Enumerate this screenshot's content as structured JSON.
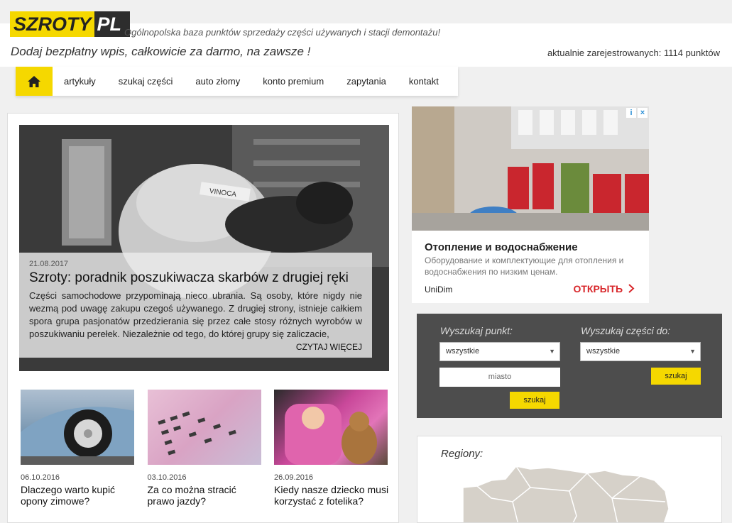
{
  "header": {
    "logo_part1": "SZROTY",
    "logo_part2": "PL",
    "tagline": "Ogólnopolska baza punktów sprzedaży części używanych i stacji demontażu!",
    "promo": "Dodaj bezpłatny wpis, całkowicie za darmo, na zawsze !",
    "registered": "aktualnie zarejestrowanych: 1114 punktów"
  },
  "nav": {
    "home_icon": "home-icon",
    "items": [
      "artykuły",
      "szukaj części",
      "auto złomy",
      "konto premium",
      "zapytania",
      "kontakt"
    ]
  },
  "hero": {
    "date": "21.08.2017",
    "title": "Szroty: poradnik poszukiwacza skarbów z drugiej ręki",
    "text": "Części samochodowe przypominają nieco ubrania. Są osoby, które nigdy nie wezmą pod uwagę zakupu czegoś używanego. Z drugiej strony, istnieje całkiem spora grupa pasjonatów przedzierania się przez całe stosy różnych wyrobów w poszukiwaniu perełek. Niezależnie od tego, do której grupy się zaliczacie,",
    "more": "CZYTAJ WIĘCEJ",
    "plate": "VINOCA"
  },
  "articles": [
    {
      "date": "06.10.2016",
      "title": "Dlaczego warto kupić opony zimowe?"
    },
    {
      "date": "03.10.2016",
      "title": "Za co można stracić prawo jazdy?"
    },
    {
      "date": "26.09.2016",
      "title": "Kiedy nasze dziecko musi korzystać z fotelika?"
    }
  ],
  "ad": {
    "title": "Отопление и водоснабжение",
    "desc": "Оборудование и комплектующие для отопления и водоснабжения по низким ценам.",
    "brand": "UniDim",
    "cta": "ОТКРЫТЬ",
    "info_icon": "info-icon",
    "close_icon": "close-icon"
  },
  "search": {
    "point_label": "Wyszukaj punkt:",
    "point_select": "wszystkie",
    "city_placeholder": "miasto",
    "point_button": "szukaj",
    "parts_label": "Wyszukaj części do:",
    "parts_select": "wszystkie",
    "parts_button": "szukaj"
  },
  "regions": {
    "label": "Regiony:"
  }
}
